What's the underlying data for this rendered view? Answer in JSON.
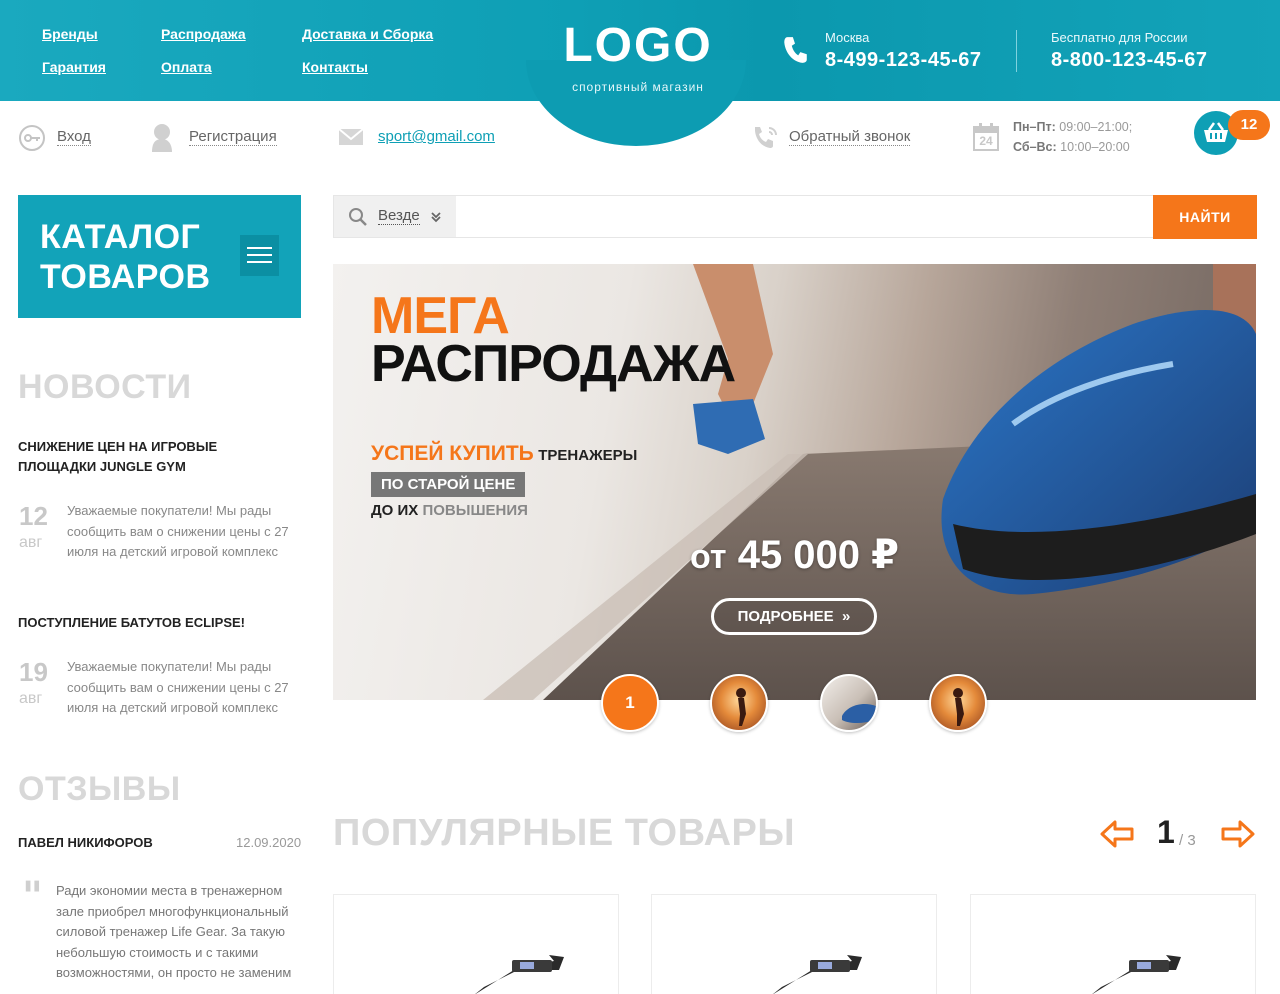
{
  "nav": {
    "brands": "Бренды",
    "sale": "Распродажа",
    "delivery": "Доставка и Сборка",
    "warranty": "Гарантия",
    "payment": "Оплата",
    "contacts": "Контакты"
  },
  "logo": {
    "text": "LOGO",
    "subtitle": "спортивный магазин"
  },
  "contacts": {
    "city1": "Москва",
    "phone1": "8-499-123-45-67",
    "city2": "Бесплатно для России",
    "phone2": "8-800-123-45-67"
  },
  "subbar": {
    "login": "Вход",
    "register": "Регистрация",
    "email": "sport@gmail.com",
    "callback": "Обратный звонок",
    "calendar_day": "24",
    "weekdays_label": "Пн–Пт:",
    "weekdays_hours": "09:00–21:00;",
    "weekend_label": "Сб–Вс:",
    "weekend_hours": "10:00–20:00",
    "cart_count": "12"
  },
  "catalog": {
    "title": "КАТАЛОГ ТОВАРОВ"
  },
  "search": {
    "scope": "Везде",
    "button": "НАЙТИ",
    "value": ""
  },
  "hero": {
    "mega": "МЕГА",
    "sale": "РАСПРОДАЖА",
    "hurry": "УСПЕЙ КУПИТЬ",
    "trainers": "ТРЕНАЖЕРЫ",
    "old_price": "ПО СТАРОЙ ЦЕНЕ",
    "before": "ДО ИХ",
    "increase": "ПОВЫШЕНИЯ",
    "price_prefix": "от",
    "price": "45 000",
    "currency": "₽",
    "more": "ПОДРОБНЕЕ"
  },
  "slider": {
    "active": "1"
  },
  "news": {
    "heading": "НОВОСТИ",
    "items": [
      {
        "title": "СНИЖЕНИЕ ЦЕН НА ИГРОВЫЕ ПЛОЩАДКИ JUNGLE GYM",
        "day": "12",
        "month": "авг",
        "text": "Уважаемые покупатели! Мы рады сообщить вам о снижении цены с 27 июля на детский игровой комплекс"
      },
      {
        "title": "ПОСТУПЛЕНИЕ БАТУТОВ ECLIPSE!",
        "day": "19",
        "month": "авг",
        "text": "Уважаемые покупатели! Мы рады сообщить вам о снижении цены с 27 июля на детский игровой комплекс"
      }
    ]
  },
  "reviews": {
    "heading": "ОТЗЫВЫ",
    "author": "ПАВЕЛ НИКИФОРОВ",
    "date": "12.09.2020",
    "text": "Ради экономии места в тренажерном зале приобрел многофункциональный силовой тренажер Life Gear. За такую небольшую стоимость и с такими возможностями, он просто не заменим"
  },
  "popular": {
    "heading": "ПОПУЛЯРНЫЕ ТОВАРЫ",
    "page": "1",
    "total": "/ 3"
  },
  "colors": {
    "teal": "#12a3b9",
    "orange": "#f5761a"
  }
}
